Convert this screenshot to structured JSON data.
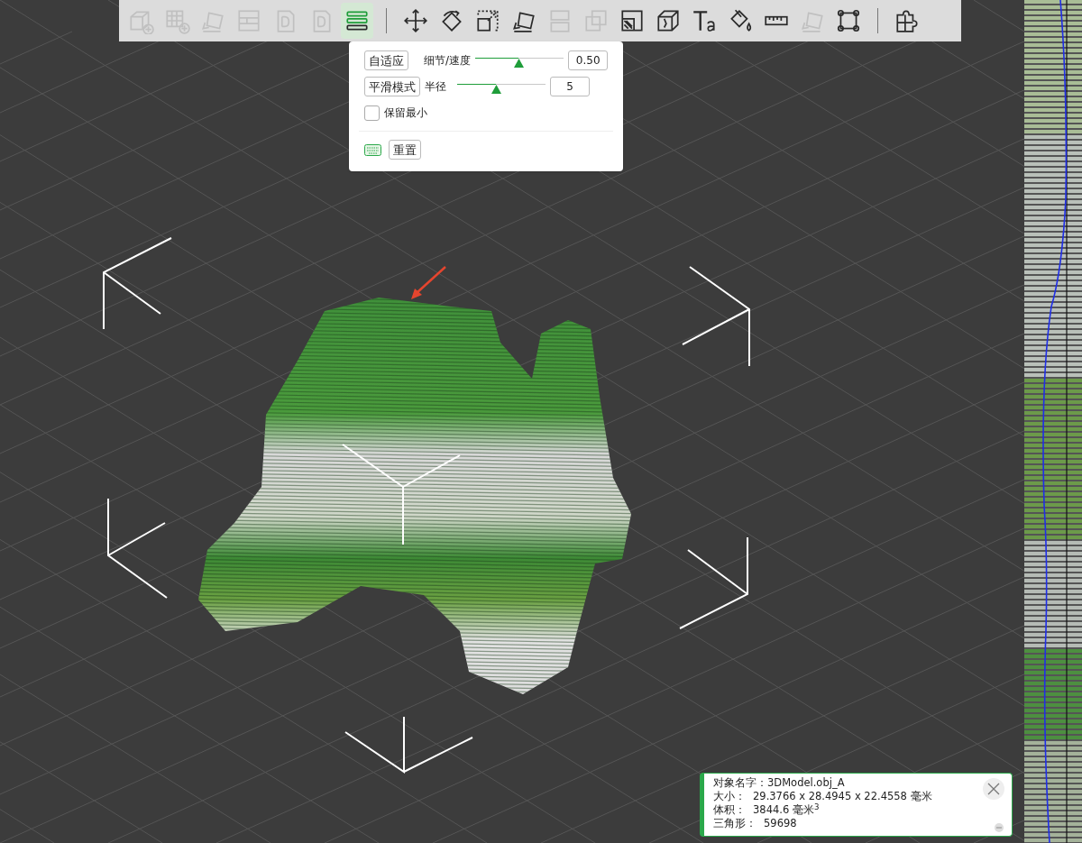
{
  "toolbar": {
    "tools": [
      {
        "kind": "tool",
        "disabled": true,
        "selected": false
      },
      {
        "kind": "tool",
        "disabled": true,
        "selected": false
      },
      {
        "kind": "tool",
        "disabled": true,
        "selected": false
      },
      {
        "kind": "tool",
        "disabled": true,
        "selected": false
      },
      {
        "kind": "tool",
        "disabled": true,
        "selected": false
      },
      {
        "kind": "tool",
        "disabled": true,
        "selected": false
      },
      {
        "kind": "tool",
        "disabled": false,
        "selected": true
      },
      {
        "kind": "separator"
      },
      {
        "kind": "tool",
        "disabled": false,
        "selected": false
      },
      {
        "kind": "tool",
        "disabled": false,
        "selected": false
      },
      {
        "kind": "tool",
        "disabled": false,
        "selected": false
      },
      {
        "kind": "tool",
        "disabled": false,
        "selected": false
      },
      {
        "kind": "tool",
        "disabled": true,
        "selected": false
      },
      {
        "kind": "tool",
        "disabled": true,
        "selected": false
      },
      {
        "kind": "tool",
        "disabled": false,
        "selected": false
      },
      {
        "kind": "tool",
        "disabled": false,
        "selected": false
      },
      {
        "kind": "tool",
        "disabled": false,
        "selected": false
      },
      {
        "kind": "tool",
        "disabled": false,
        "selected": false
      },
      {
        "kind": "tool",
        "disabled": false,
        "selected": false
      },
      {
        "kind": "tool",
        "disabled": true,
        "selected": false
      },
      {
        "kind": "tool",
        "disabled": false,
        "selected": false
      },
      {
        "kind": "separator"
      },
      {
        "kind": "tool",
        "disabled": false,
        "selected": false
      }
    ]
  },
  "smoothing_panel": {
    "adaptive_button": "自适应",
    "detail_label": "细节/速度",
    "detail_slider": {
      "level": 0.49
    },
    "detail_value": "0.50",
    "smooth_mode_button": "平滑模式",
    "radius_label": "半径",
    "radius_slider": {
      "level": 0.44
    },
    "radius_value": "5",
    "keep_min": {
      "label": "保留最小",
      "checked": false
    },
    "reset_button": "重置"
  },
  "object_info": {
    "rows": [
      {
        "label": "对象名字：",
        "value": "3DModel.obj_A"
      },
      {
        "label": "大小：",
        "value": "29.3766 x 28.4945 x 22.4558 毫米"
      },
      {
        "label": "体积：",
        "value": "3844.6 毫米$^{3}$"
      },
      {
        "label": "三角形：",
        "value": "59698"
      }
    ]
  }
}
